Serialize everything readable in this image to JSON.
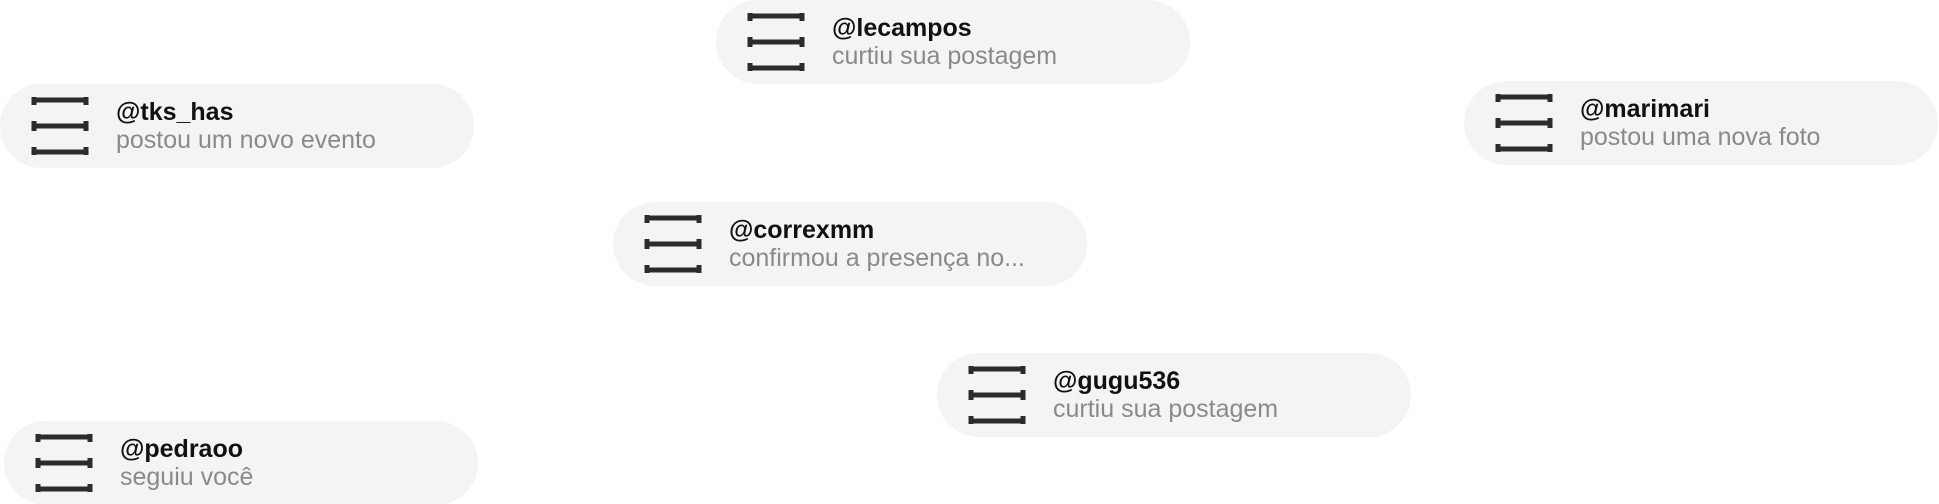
{
  "notifications": [
    {
      "icon": "placeholder-frame-icon",
      "username": "@lecampos",
      "message": "curtiu sua postagem"
    },
    {
      "icon": "placeholder-frame-icon",
      "username": "@tks_has",
      "message": "postou um novo evento"
    },
    {
      "icon": "placeholder-frame-icon",
      "username": "@marimari",
      "message": "postou uma nova foto"
    },
    {
      "icon": "placeholder-frame-icon",
      "username": "@correxmm",
      "message": "confirmou a presença no..."
    },
    {
      "icon": "placeholder-frame-icon",
      "username": "@gugu536",
      "message": "curtiu sua postagem"
    },
    {
      "icon": "placeholder-frame-icon",
      "username": "@pedraoo",
      "message": "seguiu você"
    }
  ],
  "colors": {
    "card_background": "#f4f4f4",
    "username": "#111111",
    "message": "#8a8a8a",
    "icon": "#2b2b2b"
  }
}
